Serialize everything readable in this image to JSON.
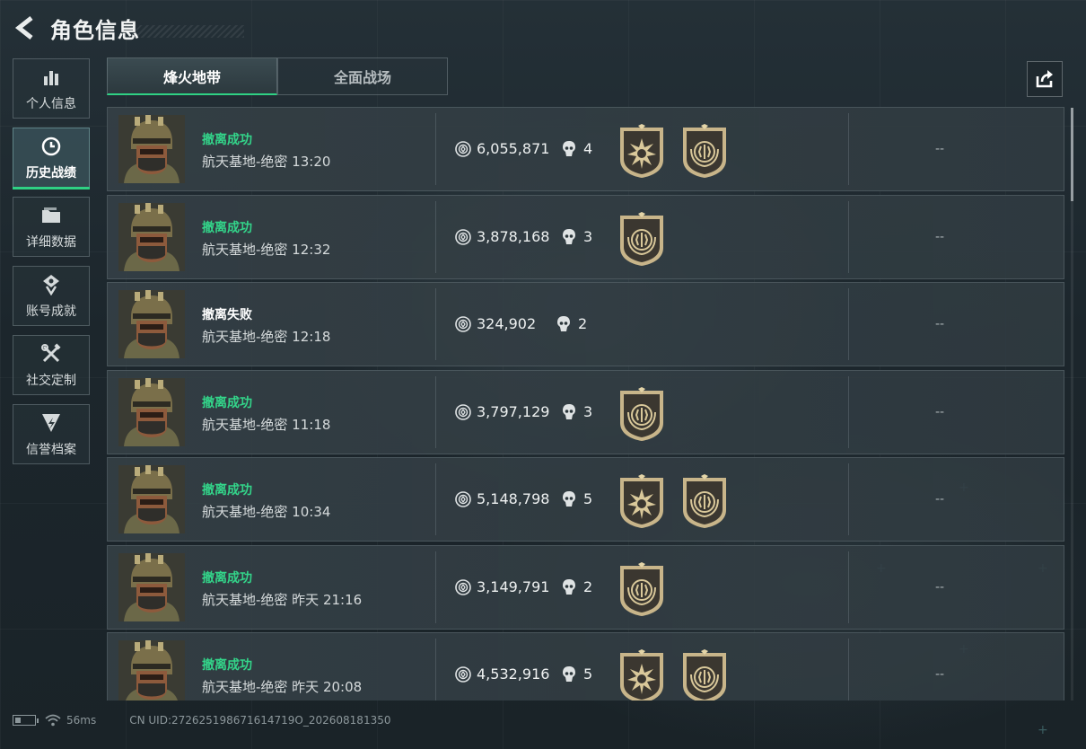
{
  "header": {
    "title": "角色信息"
  },
  "sidebar": {
    "items": [
      {
        "label": "个人信息",
        "icon": "bar-chart-icon",
        "active": false
      },
      {
        "label": "历史战绩",
        "icon": "history-clock-icon",
        "active": true
      },
      {
        "label": "详细数据",
        "icon": "folder-icon",
        "active": false
      },
      {
        "label": "账号成就",
        "icon": "achievement-icon",
        "active": false
      },
      {
        "label": "社交定制",
        "icon": "tools-icon",
        "active": false
      },
      {
        "label": "信誉档案",
        "icon": "reputation-icon",
        "active": false
      }
    ]
  },
  "tabs": [
    {
      "label": "烽火地带",
      "active": true
    },
    {
      "label": "全面战场",
      "active": false
    }
  ],
  "records": [
    {
      "status": "撤离成功",
      "success": true,
      "map": "航天基地-绝密 13:20",
      "value": "6,055,871",
      "kills": "4",
      "badges": [
        "sun-emblem-badge",
        "laurel-badge"
      ],
      "extra": "--"
    },
    {
      "status": "撤离成功",
      "success": true,
      "map": "航天基地-绝密 12:32",
      "value": "3,878,168",
      "kills": "3",
      "badges": [
        "laurel-badge"
      ],
      "extra": "--"
    },
    {
      "status": "撤离失败",
      "success": false,
      "map": "航天基地-绝密 12:18",
      "value": "324,902",
      "kills": "2",
      "badges": [],
      "extra": "--"
    },
    {
      "status": "撤离成功",
      "success": true,
      "map": "航天基地-绝密 11:18",
      "value": "3,797,129",
      "kills": "3",
      "badges": [
        "laurel-badge"
      ],
      "extra": "--"
    },
    {
      "status": "撤离成功",
      "success": true,
      "map": "航天基地-绝密 10:34",
      "value": "5,148,798",
      "kills": "5",
      "badges": [
        "sun-emblem-badge",
        "laurel-badge"
      ],
      "extra": "--"
    },
    {
      "status": "撤离成功",
      "success": true,
      "map": "航天基地-绝密 昨天 21:16",
      "value": "3,149,791",
      "kills": "2",
      "badges": [
        "laurel-badge"
      ],
      "extra": "--"
    },
    {
      "status": "撤离成功",
      "success": true,
      "map": "航天基地-绝密 昨天 20:08",
      "value": "4,532,916",
      "kills": "5",
      "badges": [
        "sun-emblem-badge",
        "laurel-badge"
      ],
      "extra": "--"
    }
  ],
  "footer": {
    "ping": "56ms",
    "uid": "CN UID:272625198671614719O_202608181350"
  },
  "colors": {
    "success": "#33d58a",
    "accent": "#2fd184",
    "badge_gold": "#c8b58a"
  }
}
